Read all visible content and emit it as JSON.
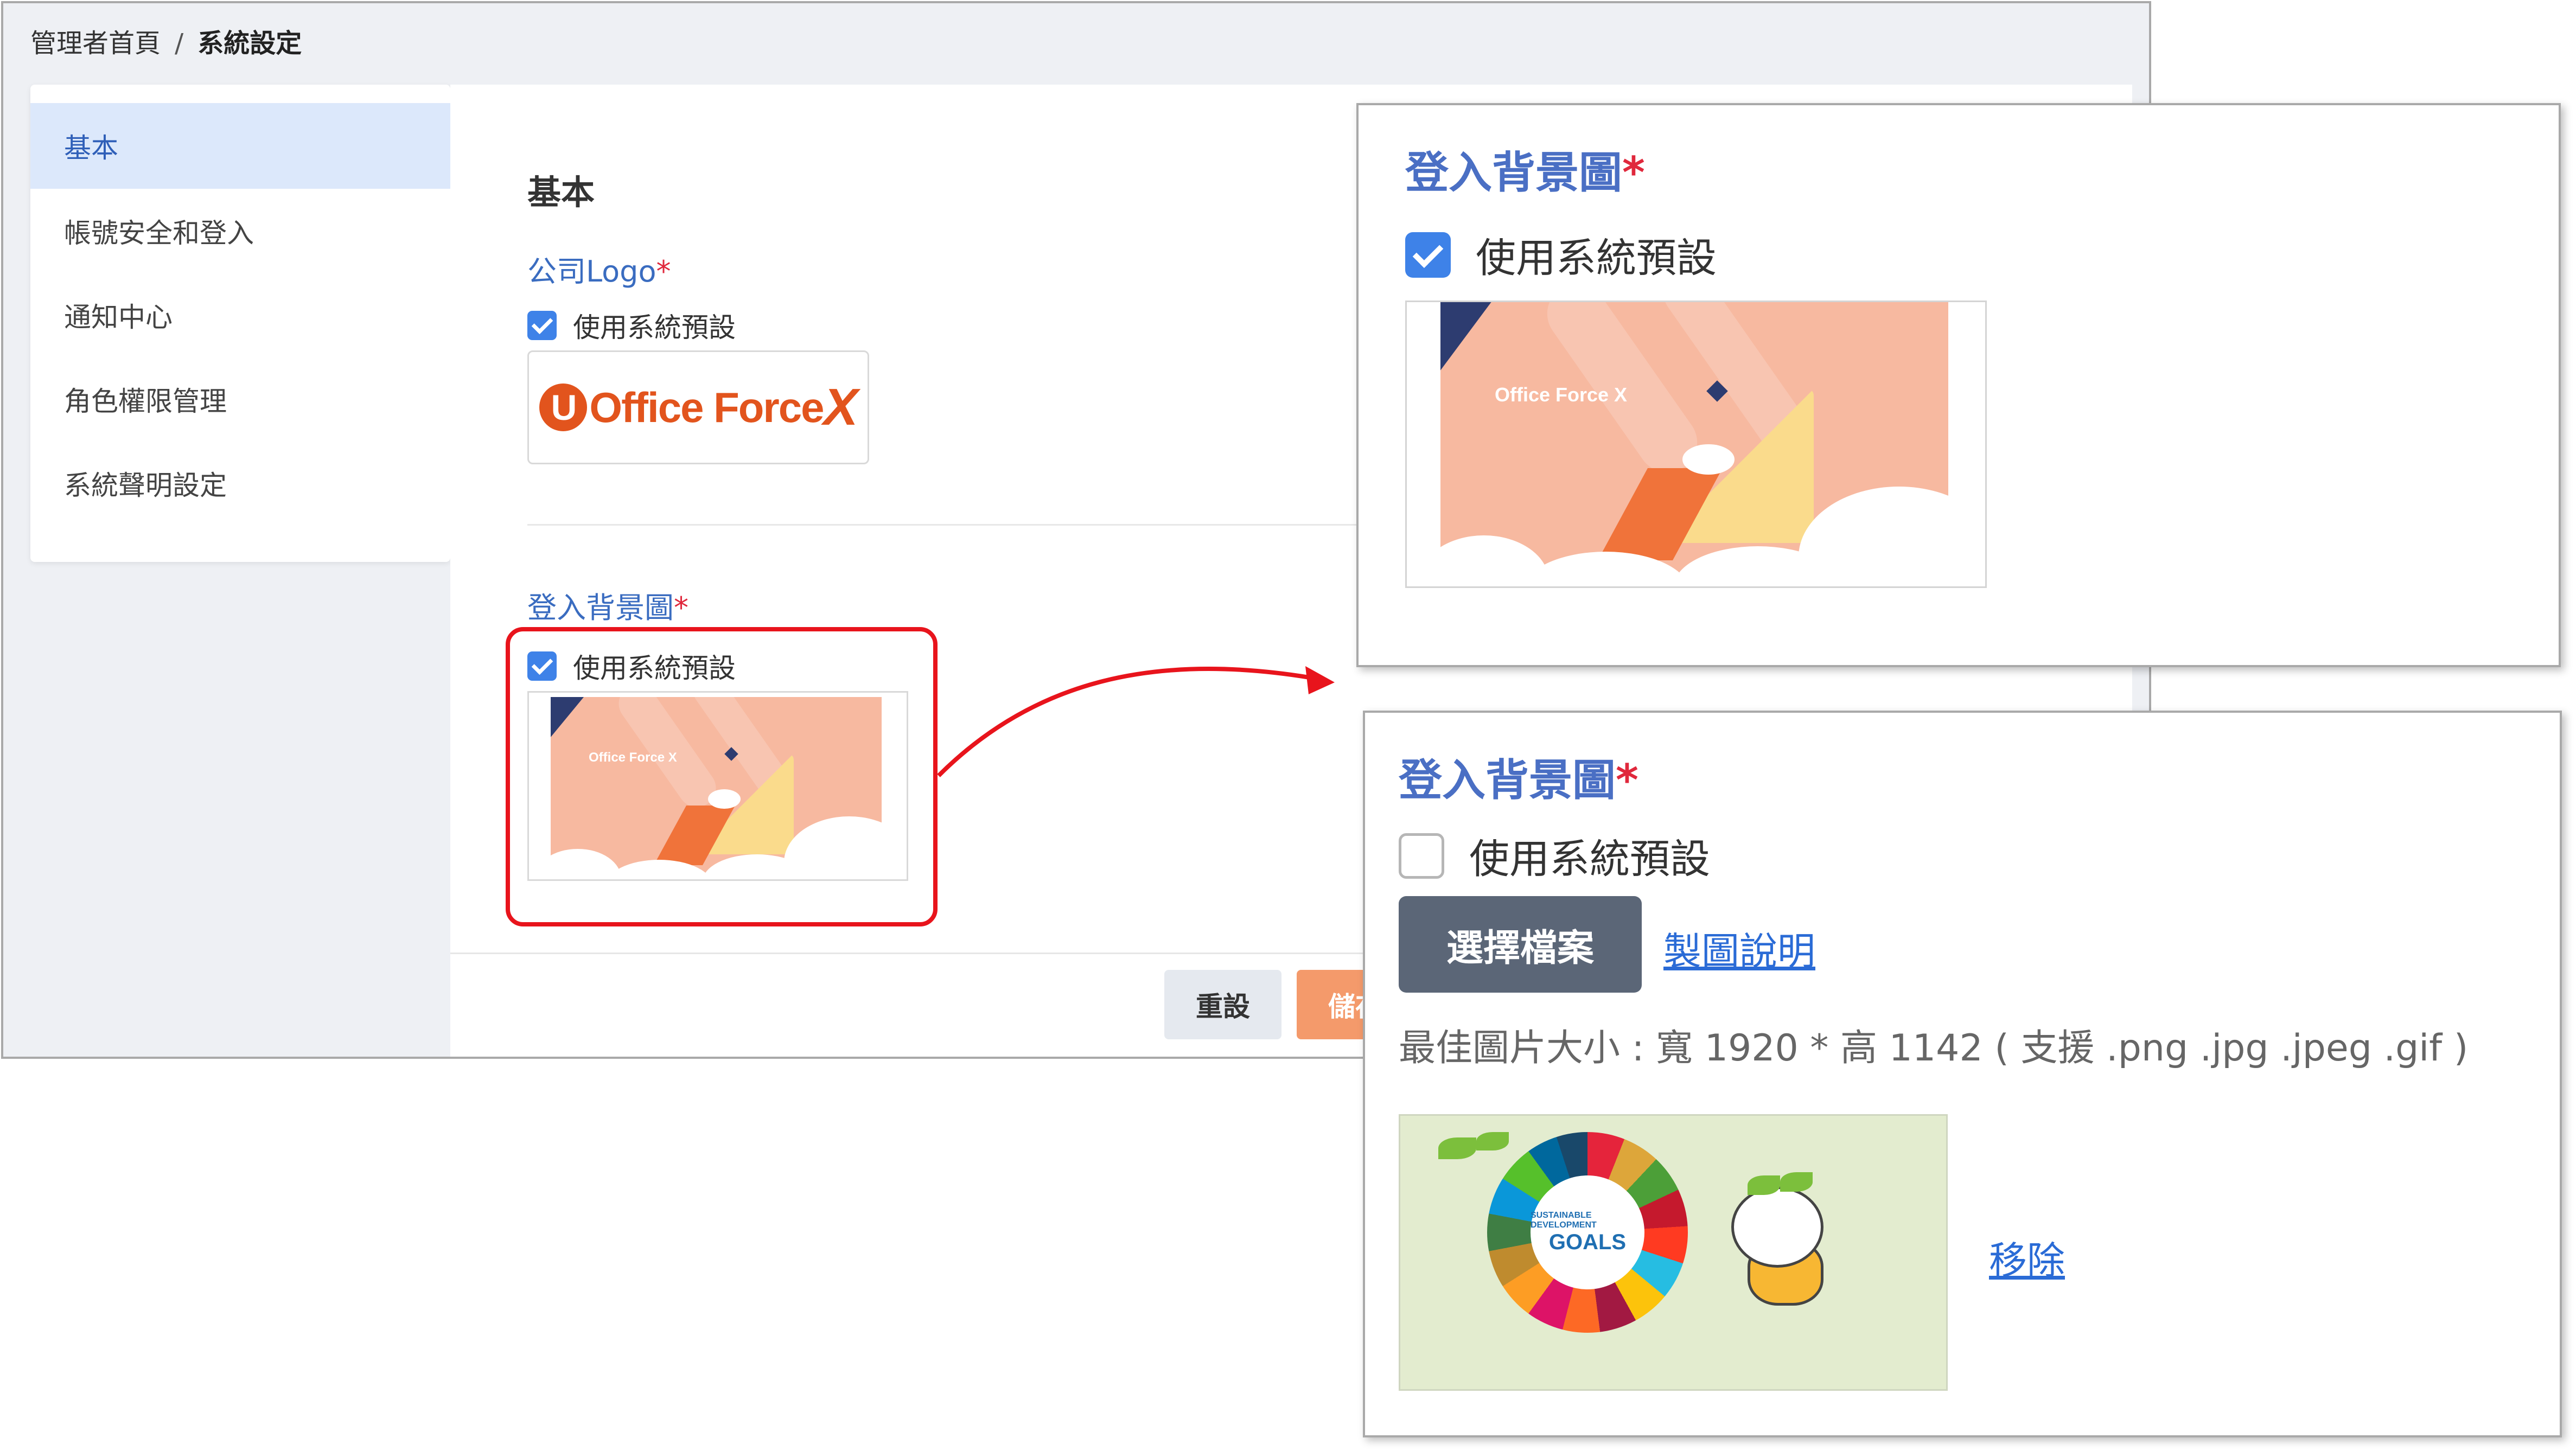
{
  "breadcrumb": {
    "home": "管理者首頁",
    "separator": "/",
    "current": "系統設定"
  },
  "sidebar": {
    "items": [
      {
        "label": "基本",
        "active": true
      },
      {
        "label": "帳號安全和登入",
        "active": false
      },
      {
        "label": "通知中心",
        "active": false
      },
      {
        "label": "角色權限管理",
        "active": false
      },
      {
        "label": "系統聲明設定",
        "active": false
      }
    ]
  },
  "main": {
    "section_title": "基本",
    "company_logo": {
      "label": "公司Logo",
      "required_mark": "*",
      "use_default_label": "使用系統預設",
      "use_default_checked": true,
      "logo_text_office": "Office Force",
      "logo_text_x": "X",
      "logo_text_u": "U"
    },
    "login_bg": {
      "label": "登入背景圖",
      "required_mark": "*",
      "use_default_label": "使用系統預設",
      "use_default_checked": true,
      "mini_logo": "Office Force X"
    },
    "buttons": {
      "reset": "重設",
      "save": "儲存"
    }
  },
  "zoom_default": {
    "title": "登入背景圖",
    "required_mark": "*",
    "use_default_label": "使用系統預設",
    "use_default_checked": true,
    "mini_logo": "Office Force X"
  },
  "zoom_custom": {
    "title": "登入背景圖",
    "required_mark": "*",
    "use_default_label": "使用系統預設",
    "use_default_checked": false,
    "choose_file": "選擇檔案",
    "guide_link": "製圖說明",
    "size_hint": "最佳圖片大小 : 寬 1920 * 高 1142 ( 支援 .png .jpg .jpeg .gif )",
    "remove_link": "移除",
    "preview": {
      "goals_text": "GOALS",
      "goals_sub": "SUSTAINABLE DEVELOPMENT"
    }
  },
  "colors": {
    "accent_blue": "#3e82e8",
    "title_blue": "#4a6fc4",
    "required_red": "#e0283c",
    "highlight_red": "#e8141c",
    "save_orange": "#f49a6b",
    "logo_orange": "#e2541d"
  },
  "icons": {
    "checkbox": "checkbox-icon",
    "arrow": "curved-arrow-icon"
  }
}
